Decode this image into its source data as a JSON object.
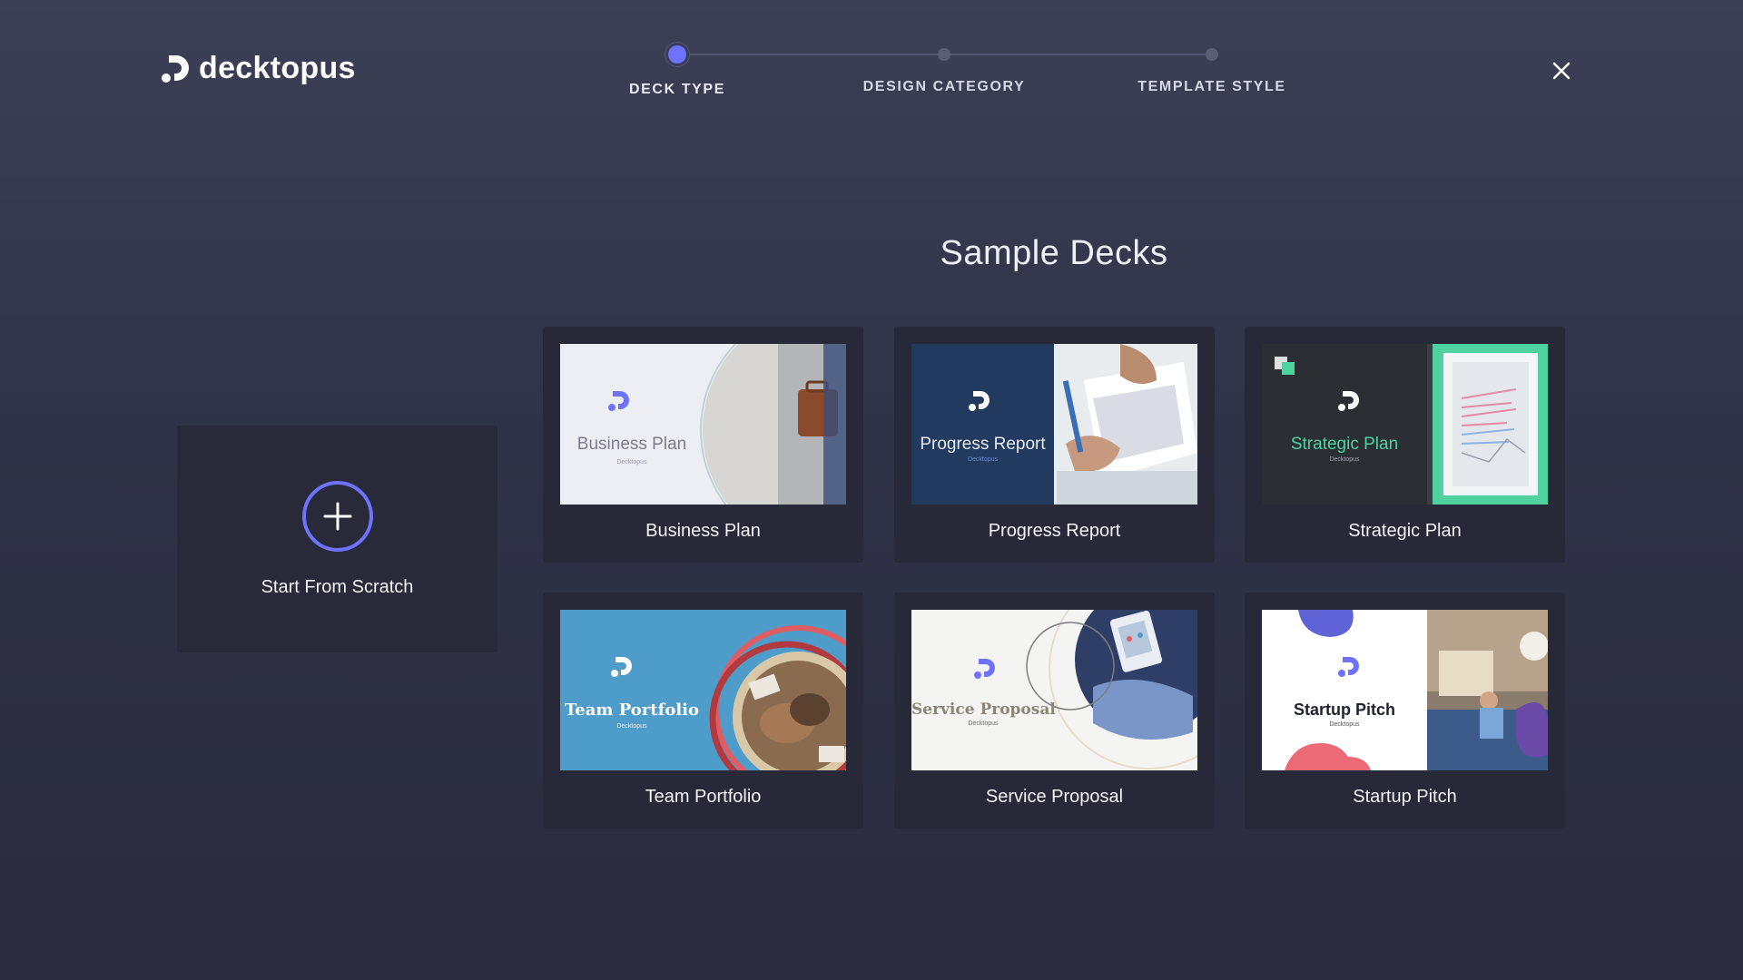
{
  "brand": {
    "name": "decktopus"
  },
  "stepper": {
    "steps": [
      {
        "label": "DECK TYPE",
        "state": "active"
      },
      {
        "label": "DESIGN CATEGORY",
        "state": "inactive"
      },
      {
        "label": "TEMPLATE STYLE",
        "state": "inactive"
      }
    ]
  },
  "close": {
    "icon": "close-icon"
  },
  "main": {
    "title": "Sample Decks",
    "scratch": {
      "label": "Start From Scratch",
      "icon": "plus-circle-icon"
    },
    "decks": [
      {
        "label": "Business Plan",
        "thumb_title": "Business Plan",
        "thumb_sub": "Decktopus"
      },
      {
        "label": "Progress Report",
        "thumb_title": "Progress Report",
        "thumb_sub": "Decktopus"
      },
      {
        "label": "Strategic Plan",
        "thumb_title": "Strategic Plan",
        "thumb_sub": "Decktopus"
      },
      {
        "label": "Team Portfolio",
        "thumb_title": "Team Portfolio",
        "thumb_sub": "Decktopus"
      },
      {
        "label": "Service Proposal",
        "thumb_title": "Service Proposal",
        "thumb_sub": "Decktopus"
      },
      {
        "label": "Startup Pitch",
        "thumb_title": "Startup Pitch",
        "thumb_sub": "Decktopus"
      }
    ]
  },
  "colors": {
    "accent": "#6e72ff",
    "background": "#30324a",
    "card": "#272938",
    "strategic_green": "#4fd1a0",
    "team_blue": "#4e9cc9"
  }
}
